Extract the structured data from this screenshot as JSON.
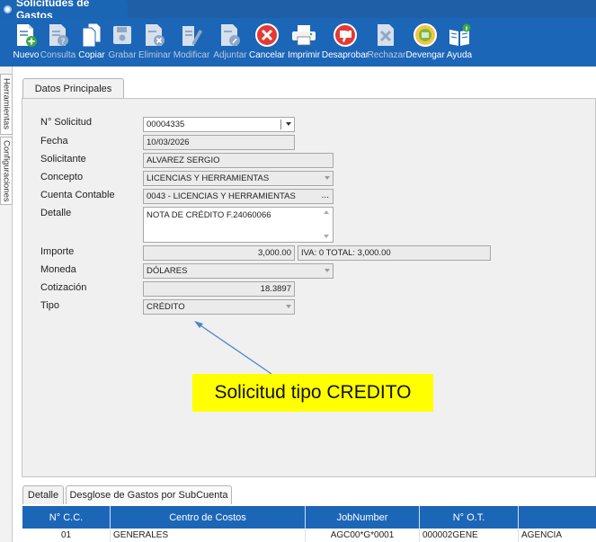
{
  "window": {
    "title": "Solicitudes de Gastos"
  },
  "toolbar": {
    "buttons": [
      {
        "label": "Nuevo",
        "icon": "new-doc-icon",
        "enabled": true
      },
      {
        "label": "Consulta",
        "icon": "query-doc-icon",
        "enabled": false
      },
      {
        "label": "Copiar",
        "icon": "copy-icon",
        "enabled": true
      },
      {
        "label": "Grabar",
        "icon": "save-icon",
        "enabled": false
      },
      {
        "label": "Eliminar",
        "icon": "delete-doc-icon",
        "enabled": false
      },
      {
        "label": "Modificar",
        "icon": "edit-icon",
        "enabled": false
      },
      {
        "label": "Adjuntar",
        "icon": "attach-icon",
        "enabled": false
      },
      {
        "label": "Cancelar",
        "icon": "cancel-icon",
        "enabled": true
      },
      {
        "label": "Imprimir",
        "icon": "print-icon",
        "enabled": true
      },
      {
        "label": "Desaprobar",
        "icon": "thumbs-down-icon",
        "enabled": true
      },
      {
        "label": "Rechazar",
        "icon": "reject-icon",
        "enabled": false
      },
      {
        "label": "Devengar",
        "icon": "accrue-icon",
        "enabled": true
      },
      {
        "label": "Ayuda",
        "icon": "help-book-icon",
        "enabled": true
      }
    ]
  },
  "side_tabs": {
    "tools": "Herramientas",
    "config": "Configuraciones"
  },
  "main_tab": {
    "label": "Datos Principales"
  },
  "form": {
    "solicitud": {
      "label": "N° Solicitud",
      "value": "00004335"
    },
    "fecha": {
      "label": "Fecha",
      "value": "10/03/2026"
    },
    "solicitante": {
      "label": "Solicitante",
      "value": "ALVAREZ SERGIO"
    },
    "concepto": {
      "label": "Concepto",
      "value": "LICENCIAS Y HERRAMIENTAS"
    },
    "cuenta": {
      "label": "Cuenta Contable",
      "value": "0043 - LICENCIAS Y HERRAMIENTAS",
      "button": "..."
    },
    "detalle": {
      "label": "Detalle",
      "value": "NOTA DE CRÉDITO F.24060066"
    },
    "importe": {
      "label": "Importe",
      "value": "3,000.00",
      "iva_total": "IVA: 0 TOTAL:  3,000.00"
    },
    "moneda": {
      "label": "Moneda",
      "value": "DÓLARES"
    },
    "cotizacion": {
      "label": "Cotización",
      "value": "18.3897"
    },
    "tipo": {
      "label": "Tipo",
      "value": "CRÉDITO"
    }
  },
  "annotation": {
    "text": "Solicitud tipo CREDITO"
  },
  "bottom_tabs": {
    "detalle": "Detalle",
    "desglose": "Desglose de Gastos por SubCuenta"
  },
  "grid": {
    "columns": [
      "N° C.C.",
      "Centro de Costos",
      "JobNumber",
      "N° O.T.",
      ""
    ],
    "rows": [
      [
        "01",
        "GENERALES",
        "AGC00*G*0001",
        "000002GENE",
        "AGENCIA"
      ]
    ]
  },
  "colors": {
    "toolbar": "#1c66b8",
    "annotation": "#ffff00",
    "arrow": "#4f86c6"
  }
}
